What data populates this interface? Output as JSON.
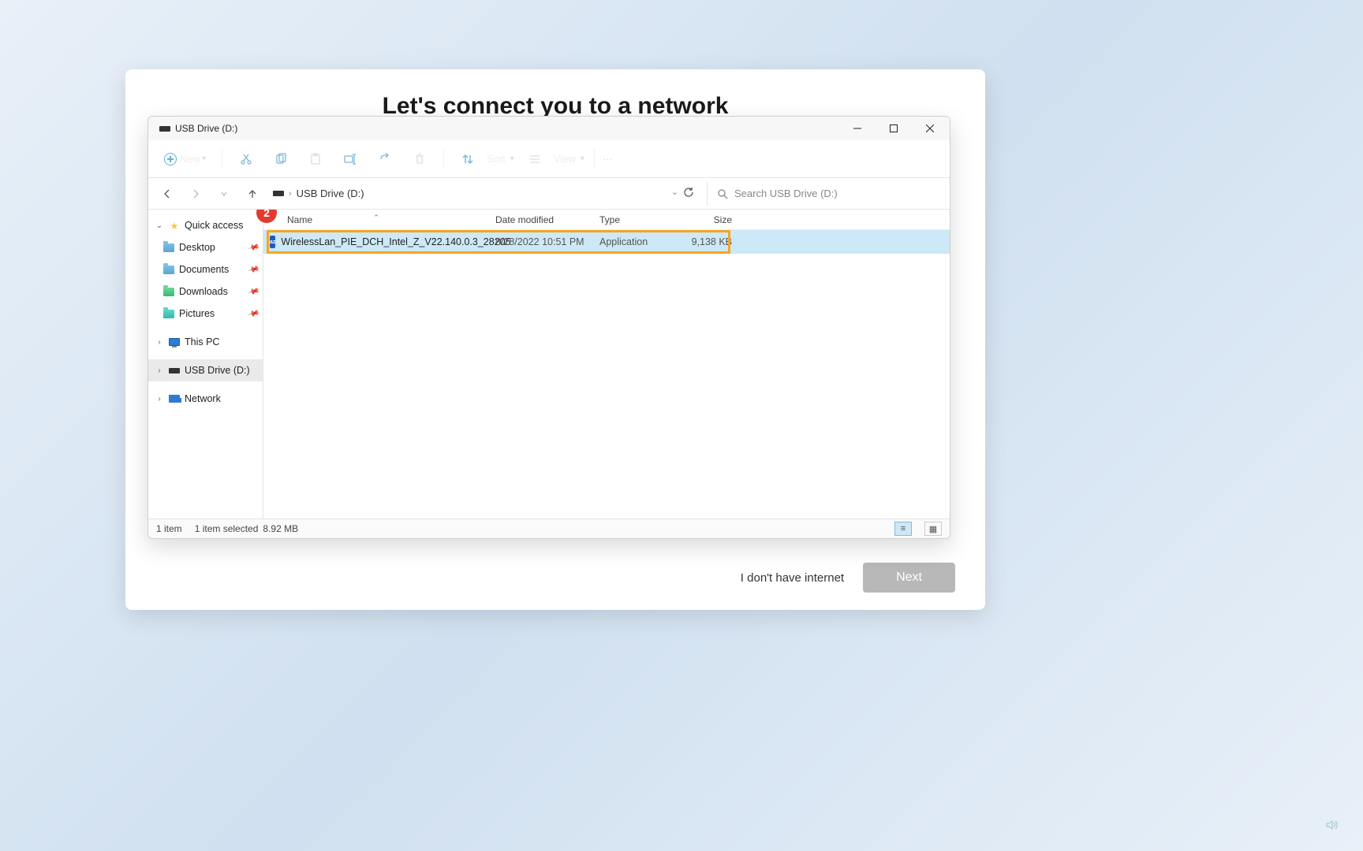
{
  "oobe": {
    "heading": "Let's connect you to a network",
    "no_internet": "I don't have internet",
    "next": "Next"
  },
  "explorer": {
    "title": "USB Drive (D:)",
    "toolbar": {
      "new": "New",
      "sort": "Sort",
      "view": "View",
      "more": "···"
    },
    "path_location": "USB Drive (D:)",
    "search_placeholder": "Search USB Drive (D:)",
    "nav": {
      "quick_access": "Quick access",
      "desktop": "Desktop",
      "documents": "Documents",
      "downloads": "Downloads",
      "pictures": "Pictures",
      "this_pc": "This PC",
      "usb_drive": "USB Drive (D:)",
      "network": "Network"
    },
    "columns": {
      "name": "Name",
      "date": "Date modified",
      "type": "Type",
      "size": "Size"
    },
    "rows": [
      {
        "name": "WirelessLan_PIE_DCH_Intel_Z_V22.140.0.3_28205",
        "date": "8/28/2022 10:51 PM",
        "type": "Application",
        "size": "9,138 KB"
      }
    ],
    "status": {
      "count": "1 item",
      "selected": "1 item selected",
      "size": "8.92 MB"
    },
    "annotation_step": "2"
  }
}
